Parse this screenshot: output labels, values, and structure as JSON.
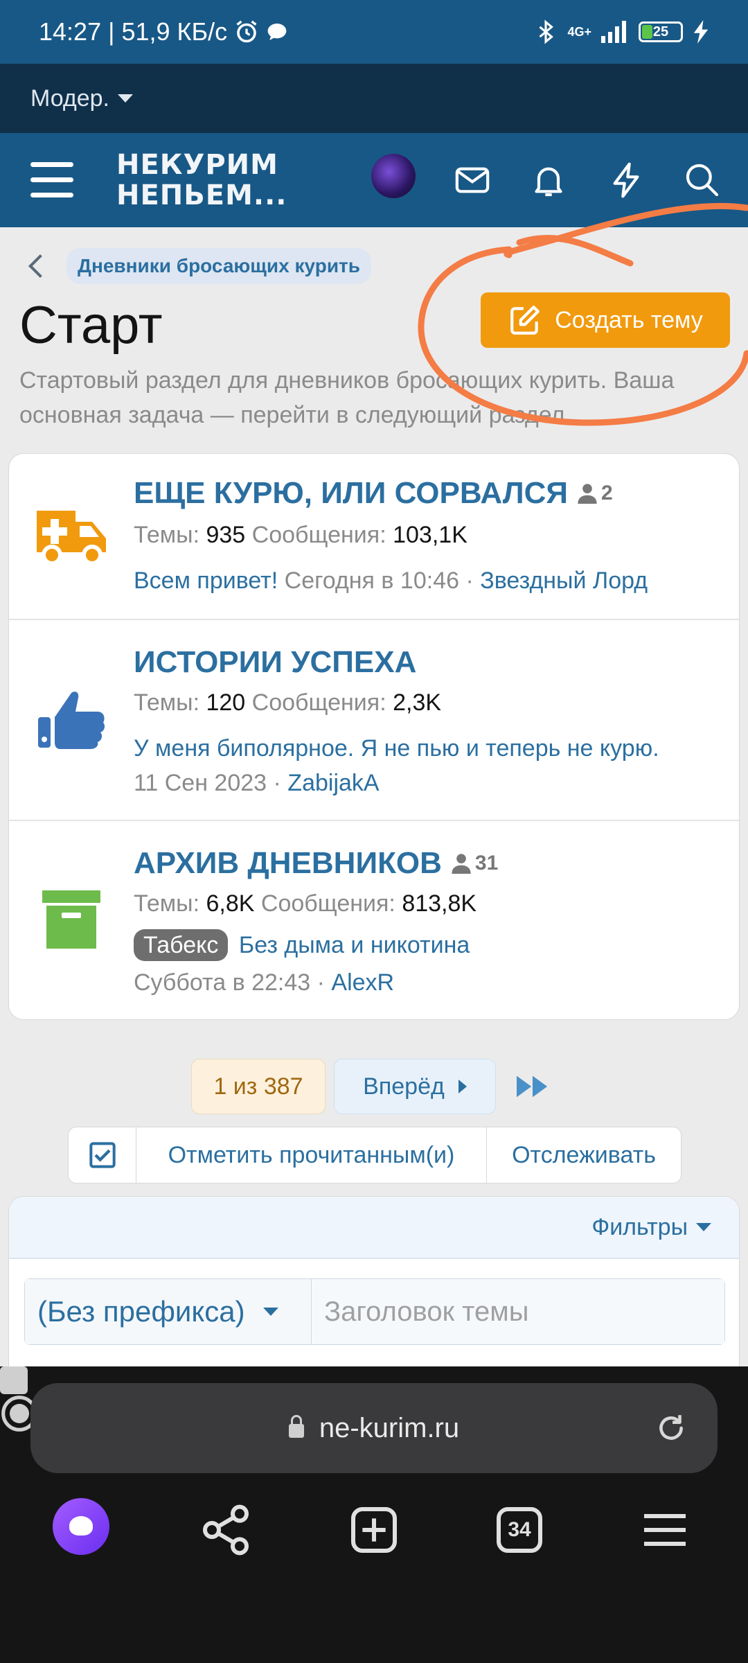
{
  "status_bar": {
    "time": "14:27",
    "speed": "51,9 КБ/с",
    "signal": "4G+",
    "battery": "25",
    "battery_level": 0.25
  },
  "mod_bar": {
    "label": "Модер."
  },
  "header": {
    "logo_line1": "НЕКУРИМ",
    "logo_line2": "НЕПЬЕМ..."
  },
  "breadcrumb": {
    "label": "Дневники бросающих курить"
  },
  "page": {
    "title": "Старт",
    "create_button": "Создать тему",
    "description": "Стартовый раздел для дневников бросающих курить. Ваша основная задача — перейти в следующий раздел."
  },
  "nodes": [
    {
      "title": "ЕЩЕ КУРЮ, ИЛИ СОРВАЛСЯ",
      "users": "2",
      "threads_label": "Темы:",
      "threads": "935",
      "posts_label": "Сообщения:",
      "posts": "103,1K",
      "last_thread": "Всем привет!",
      "last_date": "Сегодня в 10:46",
      "last_user": "Звездный Лорд",
      "icon": "ambulance-icon",
      "icon_color": "#f19a0e"
    },
    {
      "title": "ИСТОРИИ УСПЕХА",
      "threads_label": "Темы:",
      "threads": "120",
      "posts_label": "Сообщения:",
      "posts": "2,3K",
      "last_thread": "У меня биполярное. Я не пью и теперь не курю.",
      "last_date": "11 Сен 2023",
      "last_user": "ZabijakA",
      "icon": "thumbs-up-icon",
      "icon_color": "#3b73b9"
    },
    {
      "title": "АРХИВ ДНЕВНИКОВ",
      "users": "31",
      "threads_label": "Темы:",
      "threads": "6,8K",
      "posts_label": "Сообщения:",
      "posts": "813,8K",
      "prefix": "Табекс",
      "last_thread": "Без дыма и никотина",
      "last_date": "Суббота в 22:43",
      "last_user": "AlexR",
      "icon": "archive-icon",
      "icon_color": "#6dbb4b"
    }
  ],
  "pagination": {
    "current": "1 из 387",
    "next": "Вперёд"
  },
  "actions": {
    "mark_read": "Отметить прочитанным(и)",
    "watch": "Отслеживать"
  },
  "filters": {
    "label": "Фильтры",
    "prefix_select": "(Без префикса)",
    "title_placeholder": "Заголовок темы"
  },
  "browser": {
    "url": "ne-kurim.ru",
    "tabs_count": "34"
  },
  "colors": {
    "header": "#185886",
    "mod_bar": "#10304a",
    "link": "#2b6fa0",
    "accent": "#f19a0e"
  }
}
